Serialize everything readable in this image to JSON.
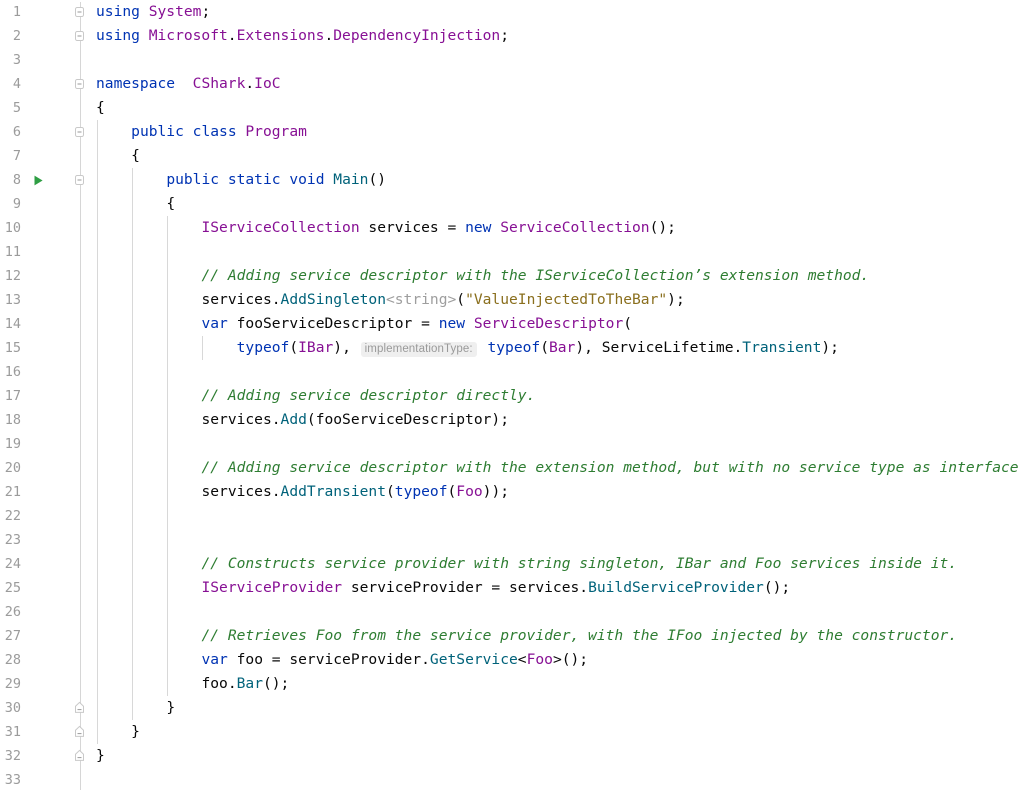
{
  "editor": {
    "language": "csharp",
    "line_height": 24,
    "first_line_top": 0,
    "total_lines_visible": 33,
    "background": "#ffffff",
    "gutter_background": "#ffffff",
    "line_number_color": "#9b9b9b",
    "indent_guide_color": "#d8d8d8",
    "run_marker_color": "#2f9e44",
    "run_marker_line": 8,
    "run_marker_name": "run-gutter-icon"
  },
  "colors": {
    "keyword": "#0033B3",
    "type": "#871094",
    "method": "#00627A",
    "string": "#8A6F1E",
    "comment": "#2E7D32",
    "generic_gray": "#9e9e9e",
    "plain": "#080808",
    "hint_background": "#efefef",
    "hint_text": "#9a9a9a"
  },
  "line_numbers": [
    1,
    2,
    3,
    4,
    5,
    6,
    7,
    8,
    9,
    10,
    11,
    12,
    13,
    14,
    15,
    16,
    17,
    18,
    19,
    20,
    21,
    22,
    23,
    24,
    25,
    26,
    27,
    28,
    29,
    30,
    31,
    32,
    33
  ],
  "fold_markers": [
    {
      "line": 1,
      "kind": "collapse-open"
    },
    {
      "line": 2,
      "kind": "collapse-open"
    },
    {
      "line": 4,
      "kind": "collapse-open"
    },
    {
      "line": 6,
      "kind": "collapse-open"
    },
    {
      "line": 8,
      "kind": "collapse-open"
    },
    {
      "line": 30,
      "kind": "collapse-close"
    },
    {
      "line": 31,
      "kind": "collapse-close"
    },
    {
      "line": 32,
      "kind": "collapse-close"
    }
  ],
  "code_lines": [
    {
      "n": 1,
      "indent": 0,
      "text": "using System;"
    },
    {
      "n": 2,
      "indent": 0,
      "text": "using Microsoft.Extensions.DependencyInjection;"
    },
    {
      "n": 3,
      "indent": 0,
      "text": ""
    },
    {
      "n": 4,
      "indent": 0,
      "text": "namespace  CShark.IoC"
    },
    {
      "n": 5,
      "indent": 0,
      "text": "{"
    },
    {
      "n": 6,
      "indent": 1,
      "text": "public class Program"
    },
    {
      "n": 7,
      "indent": 1,
      "text": "{"
    },
    {
      "n": 8,
      "indent": 2,
      "text": "public static void Main()"
    },
    {
      "n": 9,
      "indent": 2,
      "text": "{"
    },
    {
      "n": 10,
      "indent": 3,
      "text": "IServiceCollection services = new ServiceCollection();"
    },
    {
      "n": 11,
      "indent": 3,
      "text": ""
    },
    {
      "n": 12,
      "indent": 3,
      "text": "// Adding service descriptor with the IServiceCollection’s extension method."
    },
    {
      "n": 13,
      "indent": 3,
      "text": "services.AddSingleton<string>(\"ValueInjectedToTheBar\");"
    },
    {
      "n": 14,
      "indent": 3,
      "text": "var fooServiceDescriptor = new ServiceDescriptor("
    },
    {
      "n": 15,
      "indent": 4,
      "text": "typeof(IBar),  implementationType: typeof(Bar), ServiceLifetime.Transient);"
    },
    {
      "n": 16,
      "indent": 3,
      "text": ""
    },
    {
      "n": 17,
      "indent": 3,
      "text": "// Adding service descriptor directly."
    },
    {
      "n": 18,
      "indent": 3,
      "text": "services.Add(fooServiceDescriptor);"
    },
    {
      "n": 19,
      "indent": 3,
      "text": ""
    },
    {
      "n": 20,
      "indent": 3,
      "text": "// Adding service descriptor with the extension method, but with no service type as interface."
    },
    {
      "n": 21,
      "indent": 3,
      "text": "services.AddTransient(typeof(Foo));"
    },
    {
      "n": 22,
      "indent": 3,
      "text": ""
    },
    {
      "n": 23,
      "indent": 3,
      "text": ""
    },
    {
      "n": 24,
      "indent": 3,
      "text": "// Constructs service provider with string singleton, IBar and Foo services inside it."
    },
    {
      "n": 25,
      "indent": 3,
      "text": "IServiceProvider serviceProvider = services.BuildServiceProvider();"
    },
    {
      "n": 26,
      "indent": 3,
      "text": ""
    },
    {
      "n": 27,
      "indent": 3,
      "text": "// Retrieves Foo from the service provider, with the IFoo injected by the constructor."
    },
    {
      "n": 28,
      "indent": 3,
      "text": "var foo = serviceProvider.GetService<Foo>();"
    },
    {
      "n": 29,
      "indent": 3,
      "text": "foo.Bar();"
    },
    {
      "n": 30,
      "indent": 2,
      "text": "}"
    },
    {
      "n": 31,
      "indent": 1,
      "text": "}"
    },
    {
      "n": 32,
      "indent": 0,
      "text": "}"
    },
    {
      "n": 33,
      "indent": 0,
      "text": ""
    }
  ],
  "tokens": {
    "l1": [
      {
        "t": "using ",
        "c": "kw"
      },
      {
        "t": "System",
        "c": "type"
      },
      {
        "t": ";",
        "c": "pln"
      }
    ],
    "l2": [
      {
        "t": "using ",
        "c": "kw"
      },
      {
        "t": "Microsoft",
        "c": "type"
      },
      {
        "t": ".",
        "c": "pln"
      },
      {
        "t": "Extensions",
        "c": "type"
      },
      {
        "t": ".",
        "c": "pln"
      },
      {
        "t": "DependencyInjection",
        "c": "type"
      },
      {
        "t": ";",
        "c": "pln"
      }
    ],
    "l4": [
      {
        "t": "namespace",
        "c": "kw"
      },
      {
        "t": "  ",
        "c": "pln"
      },
      {
        "t": "CShark",
        "c": "type"
      },
      {
        "t": ".",
        "c": "pln"
      },
      {
        "t": "IoC",
        "c": "type"
      }
    ],
    "l5": [
      {
        "t": "{",
        "c": "pln"
      }
    ],
    "l6": [
      {
        "t": "public ",
        "c": "kw"
      },
      {
        "t": "class ",
        "c": "kw"
      },
      {
        "t": "Program",
        "c": "type"
      }
    ],
    "l7": [
      {
        "t": "{",
        "c": "pln"
      }
    ],
    "l8": [
      {
        "t": "public ",
        "c": "kw"
      },
      {
        "t": "static ",
        "c": "kw"
      },
      {
        "t": "void ",
        "c": "kw"
      },
      {
        "t": "Main",
        "c": "meth"
      },
      {
        "t": "()",
        "c": "pln"
      }
    ],
    "l9": [
      {
        "t": "{",
        "c": "pln"
      }
    ],
    "l10": [
      {
        "t": "IServiceCollection",
        "c": "type"
      },
      {
        "t": " services = ",
        "c": "pln"
      },
      {
        "t": "new ",
        "c": "kw"
      },
      {
        "t": "ServiceCollection",
        "c": "type"
      },
      {
        "t": "();",
        "c": "pln"
      }
    ],
    "l12": [
      {
        "t": "// Adding service descriptor with the IServiceCollection’s extension method.",
        "c": "cmt"
      }
    ],
    "l13": [
      {
        "t": "services.",
        "c": "pln"
      },
      {
        "t": "AddSingleton",
        "c": "meth"
      },
      {
        "t": "<string>",
        "c": "gry"
      },
      {
        "t": "(",
        "c": "pln"
      },
      {
        "t": "\"ValueInjectedToTheBar\"",
        "c": "str"
      },
      {
        "t": ");",
        "c": "pln"
      }
    ],
    "l14": [
      {
        "t": "var ",
        "c": "kw"
      },
      {
        "t": "fooServiceDescriptor = ",
        "c": "pln"
      },
      {
        "t": "new ",
        "c": "kw"
      },
      {
        "t": "ServiceDescriptor",
        "c": "type"
      },
      {
        "t": "(",
        "c": "pln"
      }
    ],
    "l15a": [
      {
        "t": "typeof",
        "c": "kw"
      },
      {
        "t": "(",
        "c": "pln"
      },
      {
        "t": "IBar",
        "c": "type"
      },
      {
        "t": "), ",
        "c": "pln"
      }
    ],
    "l15hint": "implementationType:",
    "l15b": [
      {
        "t": " ",
        "c": "pln"
      },
      {
        "t": "typeof",
        "c": "kw"
      },
      {
        "t": "(",
        "c": "pln"
      },
      {
        "t": "Bar",
        "c": "type"
      },
      {
        "t": "), ",
        "c": "pln"
      },
      {
        "t": "ServiceLifetime",
        "c": "pln"
      },
      {
        "t": ".",
        "c": "pln"
      },
      {
        "t": "Transient",
        "c": "meth"
      },
      {
        "t": ");",
        "c": "pln"
      }
    ],
    "l17": [
      {
        "t": "// Adding service descriptor directly.",
        "c": "cmt"
      }
    ],
    "l18": [
      {
        "t": "services.",
        "c": "pln"
      },
      {
        "t": "Add",
        "c": "meth"
      },
      {
        "t": "(fooServiceDescriptor);",
        "c": "pln"
      }
    ],
    "l20": [
      {
        "t": "// Adding service descriptor with the extension method, but with no service type as interface.",
        "c": "cmt"
      }
    ],
    "l21": [
      {
        "t": "services.",
        "c": "pln"
      },
      {
        "t": "AddTransient",
        "c": "meth"
      },
      {
        "t": "(",
        "c": "pln"
      },
      {
        "t": "typeof",
        "c": "kw"
      },
      {
        "t": "(",
        "c": "pln"
      },
      {
        "t": "Foo",
        "c": "type"
      },
      {
        "t": "));",
        "c": "pln"
      }
    ],
    "l24": [
      {
        "t": "// Constructs service provider with string singleton, IBar and Foo services inside it.",
        "c": "cmt"
      }
    ],
    "l25": [
      {
        "t": "IServiceProvider",
        "c": "type"
      },
      {
        "t": " serviceProvider = services.",
        "c": "pln"
      },
      {
        "t": "BuildServiceProvider",
        "c": "meth"
      },
      {
        "t": "();",
        "c": "pln"
      }
    ],
    "l27": [
      {
        "t": "// Retrieves Foo from the service provider, with the IFoo injected by the constructor.",
        "c": "cmt"
      }
    ],
    "l28": [
      {
        "t": "var ",
        "c": "kw"
      },
      {
        "t": "foo = serviceProvider.",
        "c": "pln"
      },
      {
        "t": "GetService",
        "c": "meth"
      },
      {
        "t": "<",
        "c": "pln"
      },
      {
        "t": "Foo",
        "c": "type"
      },
      {
        "t": ">();",
        "c": "pln"
      }
    ],
    "l29": [
      {
        "t": "foo.",
        "c": "pln"
      },
      {
        "t": "Bar",
        "c": "meth"
      },
      {
        "t": "();",
        "c": "pln"
      }
    ],
    "l30": [
      {
        "t": "}",
        "c": "pln"
      }
    ],
    "l31": [
      {
        "t": "}",
        "c": "pln"
      }
    ],
    "l32": [
      {
        "t": "}",
        "c": "pln"
      }
    ]
  }
}
